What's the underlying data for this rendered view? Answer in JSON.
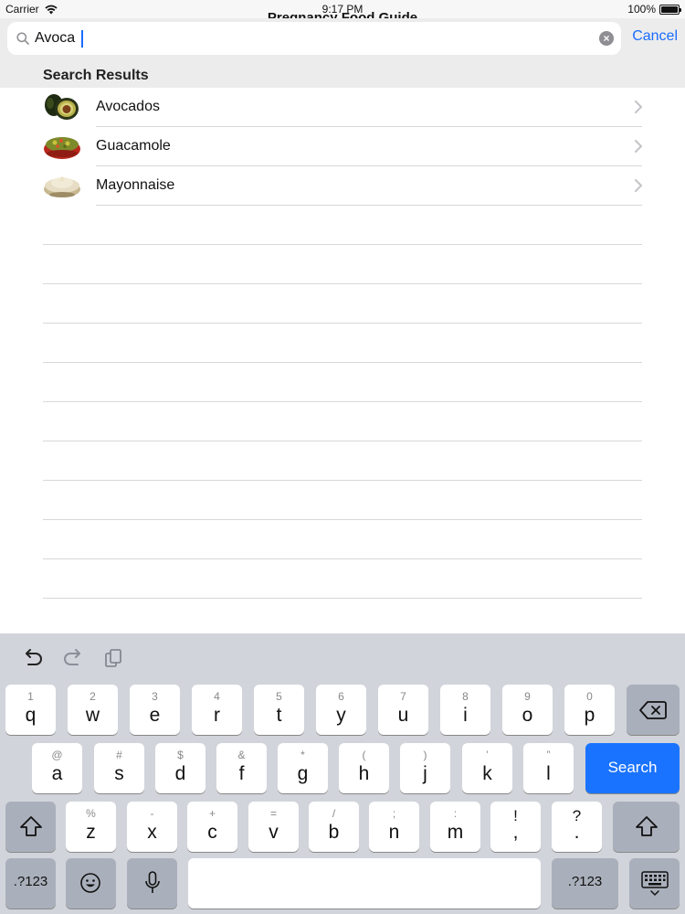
{
  "status_bar": {
    "carrier": "Carrier",
    "time": "9:17 PM",
    "battery": "100%"
  },
  "nav": {
    "title": "Pregnancy Food Guide"
  },
  "search": {
    "value": "Avoca",
    "cancel_label": "Cancel"
  },
  "section_header": "Search Results",
  "results": [
    {
      "label": "Avocados",
      "icon": "avocado-icon"
    },
    {
      "label": "Guacamole",
      "icon": "guacamole-icon"
    },
    {
      "label": "Mayonnaise",
      "icon": "mayonnaise-icon"
    }
  ],
  "keyboard": {
    "row1": [
      {
        "main": "q",
        "alt": "1"
      },
      {
        "main": "w",
        "alt": "2"
      },
      {
        "main": "e",
        "alt": "3"
      },
      {
        "main": "r",
        "alt": "4"
      },
      {
        "main": "t",
        "alt": "5"
      },
      {
        "main": "y",
        "alt": "6"
      },
      {
        "main": "u",
        "alt": "7"
      },
      {
        "main": "i",
        "alt": "8"
      },
      {
        "main": "o",
        "alt": "9"
      },
      {
        "main": "p",
        "alt": "0"
      }
    ],
    "row2": [
      {
        "main": "a",
        "alt": "@"
      },
      {
        "main": "s",
        "alt": "#"
      },
      {
        "main": "d",
        "alt": "$"
      },
      {
        "main": "f",
        "alt": "&"
      },
      {
        "main": "g",
        "alt": "*"
      },
      {
        "main": "h",
        "alt": "("
      },
      {
        "main": "j",
        "alt": ")"
      },
      {
        "main": "k",
        "alt": "’"
      },
      {
        "main": "l",
        "alt": "”"
      }
    ],
    "row3": [
      {
        "main": "z",
        "alt": "%"
      },
      {
        "main": "x",
        "alt": "-"
      },
      {
        "main": "c",
        "alt": "+"
      },
      {
        "main": "v",
        "alt": "="
      },
      {
        "main": "b",
        "alt": "/"
      },
      {
        "main": "n",
        "alt": ";"
      },
      {
        "main": "m",
        "alt": ":"
      },
      {
        "main": ",",
        "alt": "!"
      },
      {
        "main": ".",
        "alt": "?"
      }
    ],
    "search_label": "Search",
    "numbers_label": ".?123"
  },
  "colors": {
    "accent": "#1a6cff",
    "keyboard_bg": "#d1d4da"
  }
}
